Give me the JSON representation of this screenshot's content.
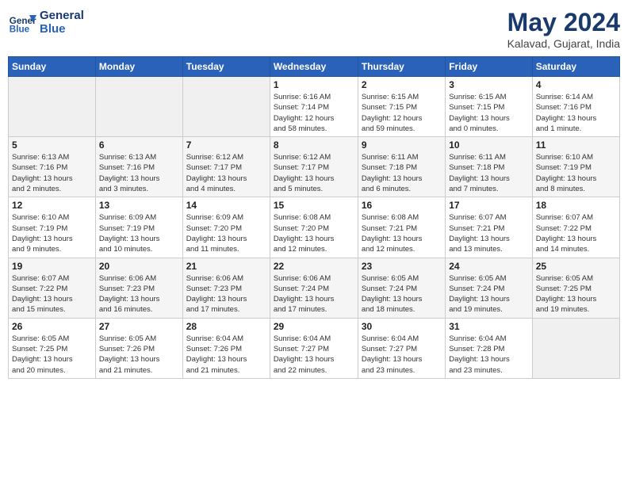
{
  "logo": {
    "line1": "General",
    "line2": "Blue"
  },
  "title": "May 2024",
  "location": "Kalavad, Gujarat, India",
  "weekdays": [
    "Sunday",
    "Monday",
    "Tuesday",
    "Wednesday",
    "Thursday",
    "Friday",
    "Saturday"
  ],
  "weeks": [
    [
      {
        "day": "",
        "info": ""
      },
      {
        "day": "",
        "info": ""
      },
      {
        "day": "",
        "info": ""
      },
      {
        "day": "1",
        "info": "Sunrise: 6:16 AM\nSunset: 7:14 PM\nDaylight: 12 hours\nand 58 minutes."
      },
      {
        "day": "2",
        "info": "Sunrise: 6:15 AM\nSunset: 7:15 PM\nDaylight: 12 hours\nand 59 minutes."
      },
      {
        "day": "3",
        "info": "Sunrise: 6:15 AM\nSunset: 7:15 PM\nDaylight: 13 hours\nand 0 minutes."
      },
      {
        "day": "4",
        "info": "Sunrise: 6:14 AM\nSunset: 7:16 PM\nDaylight: 13 hours\nand 1 minute."
      }
    ],
    [
      {
        "day": "5",
        "info": "Sunrise: 6:13 AM\nSunset: 7:16 PM\nDaylight: 13 hours\nand 2 minutes."
      },
      {
        "day": "6",
        "info": "Sunrise: 6:13 AM\nSunset: 7:16 PM\nDaylight: 13 hours\nand 3 minutes."
      },
      {
        "day": "7",
        "info": "Sunrise: 6:12 AM\nSunset: 7:17 PM\nDaylight: 13 hours\nand 4 minutes."
      },
      {
        "day": "8",
        "info": "Sunrise: 6:12 AM\nSunset: 7:17 PM\nDaylight: 13 hours\nand 5 minutes."
      },
      {
        "day": "9",
        "info": "Sunrise: 6:11 AM\nSunset: 7:18 PM\nDaylight: 13 hours\nand 6 minutes."
      },
      {
        "day": "10",
        "info": "Sunrise: 6:11 AM\nSunset: 7:18 PM\nDaylight: 13 hours\nand 7 minutes."
      },
      {
        "day": "11",
        "info": "Sunrise: 6:10 AM\nSunset: 7:19 PM\nDaylight: 13 hours\nand 8 minutes."
      }
    ],
    [
      {
        "day": "12",
        "info": "Sunrise: 6:10 AM\nSunset: 7:19 PM\nDaylight: 13 hours\nand 9 minutes."
      },
      {
        "day": "13",
        "info": "Sunrise: 6:09 AM\nSunset: 7:19 PM\nDaylight: 13 hours\nand 10 minutes."
      },
      {
        "day": "14",
        "info": "Sunrise: 6:09 AM\nSunset: 7:20 PM\nDaylight: 13 hours\nand 11 minutes."
      },
      {
        "day": "15",
        "info": "Sunrise: 6:08 AM\nSunset: 7:20 PM\nDaylight: 13 hours\nand 12 minutes."
      },
      {
        "day": "16",
        "info": "Sunrise: 6:08 AM\nSunset: 7:21 PM\nDaylight: 13 hours\nand 12 minutes."
      },
      {
        "day": "17",
        "info": "Sunrise: 6:07 AM\nSunset: 7:21 PM\nDaylight: 13 hours\nand 13 minutes."
      },
      {
        "day": "18",
        "info": "Sunrise: 6:07 AM\nSunset: 7:22 PM\nDaylight: 13 hours\nand 14 minutes."
      }
    ],
    [
      {
        "day": "19",
        "info": "Sunrise: 6:07 AM\nSunset: 7:22 PM\nDaylight: 13 hours\nand 15 minutes."
      },
      {
        "day": "20",
        "info": "Sunrise: 6:06 AM\nSunset: 7:23 PM\nDaylight: 13 hours\nand 16 minutes."
      },
      {
        "day": "21",
        "info": "Sunrise: 6:06 AM\nSunset: 7:23 PM\nDaylight: 13 hours\nand 17 minutes."
      },
      {
        "day": "22",
        "info": "Sunrise: 6:06 AM\nSunset: 7:24 PM\nDaylight: 13 hours\nand 17 minutes."
      },
      {
        "day": "23",
        "info": "Sunrise: 6:05 AM\nSunset: 7:24 PM\nDaylight: 13 hours\nand 18 minutes."
      },
      {
        "day": "24",
        "info": "Sunrise: 6:05 AM\nSunset: 7:24 PM\nDaylight: 13 hours\nand 19 minutes."
      },
      {
        "day": "25",
        "info": "Sunrise: 6:05 AM\nSunset: 7:25 PM\nDaylight: 13 hours\nand 19 minutes."
      }
    ],
    [
      {
        "day": "26",
        "info": "Sunrise: 6:05 AM\nSunset: 7:25 PM\nDaylight: 13 hours\nand 20 minutes."
      },
      {
        "day": "27",
        "info": "Sunrise: 6:05 AM\nSunset: 7:26 PM\nDaylight: 13 hours\nand 21 minutes."
      },
      {
        "day": "28",
        "info": "Sunrise: 6:04 AM\nSunset: 7:26 PM\nDaylight: 13 hours\nand 21 minutes."
      },
      {
        "day": "29",
        "info": "Sunrise: 6:04 AM\nSunset: 7:27 PM\nDaylight: 13 hours\nand 22 minutes."
      },
      {
        "day": "30",
        "info": "Sunrise: 6:04 AM\nSunset: 7:27 PM\nDaylight: 13 hours\nand 23 minutes."
      },
      {
        "day": "31",
        "info": "Sunrise: 6:04 AM\nSunset: 7:28 PM\nDaylight: 13 hours\nand 23 minutes."
      },
      {
        "day": "",
        "info": ""
      }
    ]
  ]
}
